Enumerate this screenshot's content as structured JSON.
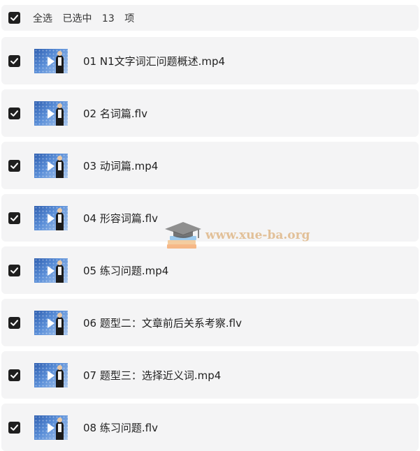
{
  "header": {
    "select_all_label": "全选",
    "selected_label": "已选中",
    "selected_count": "13",
    "unit_label": "项"
  },
  "files": [
    {
      "name": "01 N1文字词汇问题概述.mp4",
      "checked": true
    },
    {
      "name": "02 名词篇.flv",
      "checked": true
    },
    {
      "name": "03 动词篇.mp4",
      "checked": true
    },
    {
      "name": "04 形容词篇.flv",
      "checked": true
    },
    {
      "name": "05 练习问题.mp4",
      "checked": true
    },
    {
      "name": "06 题型二：文章前后关系考察.flv",
      "checked": true
    },
    {
      "name": "07 题型三：选择近义词.mp4",
      "checked": true
    },
    {
      "name": "08 练习问题.flv",
      "checked": true
    }
  ],
  "watermark": {
    "text": "www.xue-ba.org",
    "icon": "graduation-cap-books-icon"
  },
  "colors": {
    "row_background": "#f4f4f5",
    "checkbox": "#1f1f1f",
    "watermark": "#dcaf78"
  }
}
